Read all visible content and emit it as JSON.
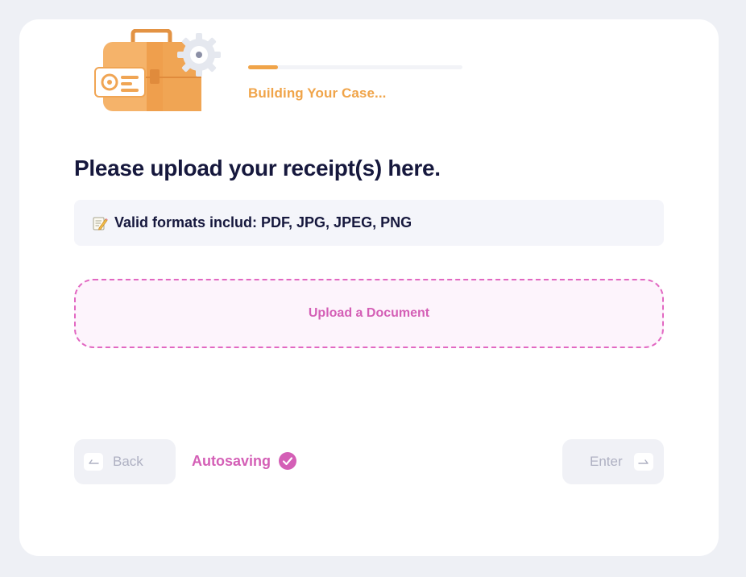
{
  "progress": {
    "label": "Building Your Case...",
    "fraction": 0.14
  },
  "question": {
    "title": "Please upload your receipt(s) here."
  },
  "info": {
    "icon": "memo-pencil-icon",
    "text": "Valid formats includ: PDF, JPG, JPEG, PNG"
  },
  "upload": {
    "label": "Upload a Document"
  },
  "footer": {
    "back_label": "Back",
    "autosave_label": "Autosaving",
    "enter_label": "Enter"
  },
  "colors": {
    "accent_orange": "#f0a449",
    "accent_pink": "#d45fb6",
    "title_navy": "#16183d"
  }
}
